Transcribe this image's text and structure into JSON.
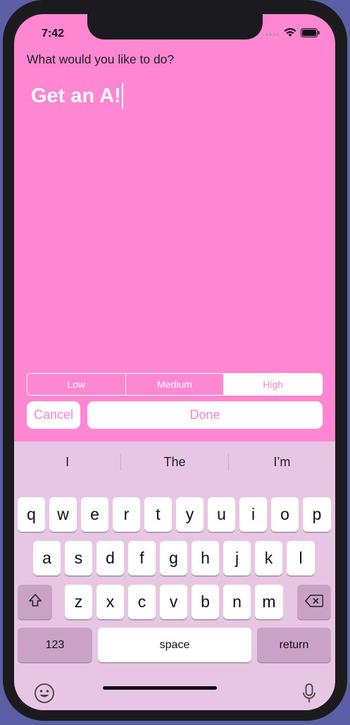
{
  "status": {
    "time": "7:42"
  },
  "prompt": "What would you like to do?",
  "todo_text": "Get an A!",
  "priority": {
    "options": [
      "Low",
      "Medium",
      "High"
    ],
    "selected": "High"
  },
  "buttons": {
    "cancel": "Cancel",
    "done": "Done"
  },
  "keyboard": {
    "suggestions": [
      "I",
      "The",
      "I’m"
    ],
    "row1": [
      "q",
      "w",
      "e",
      "r",
      "t",
      "y",
      "u",
      "i",
      "o",
      "p"
    ],
    "row2": [
      "a",
      "s",
      "d",
      "f",
      "g",
      "h",
      "j",
      "k",
      "l"
    ],
    "row3": [
      "z",
      "x",
      "c",
      "v",
      "b",
      "n",
      "m"
    ],
    "numbers_label": "123",
    "space_label": "space",
    "return_label": "return"
  },
  "colors": {
    "accent": "#ff86d0",
    "keyboard_bg": "#e6c6e3",
    "dark_key": "#c9a2c5"
  }
}
